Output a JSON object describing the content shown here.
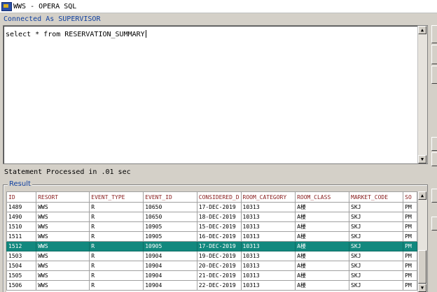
{
  "window": {
    "title": "WWS - OPERA SQL",
    "connection_status": "Connected As SUPERVISOR"
  },
  "editor": {
    "query_text": "select * from RESERVATION_SUMMARY"
  },
  "status_text": "Statement Processed in .01 sec",
  "result": {
    "label": "Result",
    "columns": [
      "ID",
      "RESORT",
      "EVENT_TYPE",
      "EVENT_ID",
      "CONSIDERED_D",
      "ROOM_CATEGORY",
      "ROOM_CLASS",
      "MARKET_CODE",
      "SO"
    ],
    "rows": [
      [
        "1489",
        "WWS",
        "R",
        "10650",
        "17-DEC-2019",
        "10313",
        "A楼",
        "SKJ",
        "PM"
      ],
      [
        "1490",
        "WWS",
        "R",
        "10650",
        "18-DEC-2019",
        "10313",
        "A楼",
        "SKJ",
        "PM"
      ],
      [
        "1510",
        "WWS",
        "R",
        "10905",
        "15-DEC-2019",
        "10313",
        "A楼",
        "SKJ",
        "PM"
      ],
      [
        "1511",
        "WWS",
        "R",
        "10905",
        "16-DEC-2019",
        "10313",
        "A楼",
        "SKJ",
        "PM"
      ],
      [
        "1512",
        "WWS",
        "R",
        "10905",
        "17-DEC-2019",
        "10313",
        "A楼",
        "SKJ",
        "PM"
      ],
      [
        "1503",
        "WWS",
        "R",
        "10904",
        "19-DEC-2019",
        "10313",
        "A楼",
        "SKJ",
        "PM"
      ],
      [
        "1504",
        "WWS",
        "R",
        "10904",
        "20-DEC-2019",
        "10313",
        "A楼",
        "SKJ",
        "PM"
      ],
      [
        "1505",
        "WWS",
        "R",
        "10904",
        "21-DEC-2019",
        "10313",
        "A楼",
        "SKJ",
        "PM"
      ],
      [
        "1506",
        "WWS",
        "R",
        "10904",
        "22-DEC-2019",
        "10313",
        "A楼",
        "SKJ",
        "PM"
      ]
    ],
    "selected_row": 4
  },
  "icons": {
    "app": "opera-app-icon",
    "scroll_up": "▲",
    "scroll_down": "▼"
  },
  "colors": {
    "selected_row_bg": "#12887e",
    "header_text": "#8a2020",
    "info_text": "#1040a0"
  }
}
